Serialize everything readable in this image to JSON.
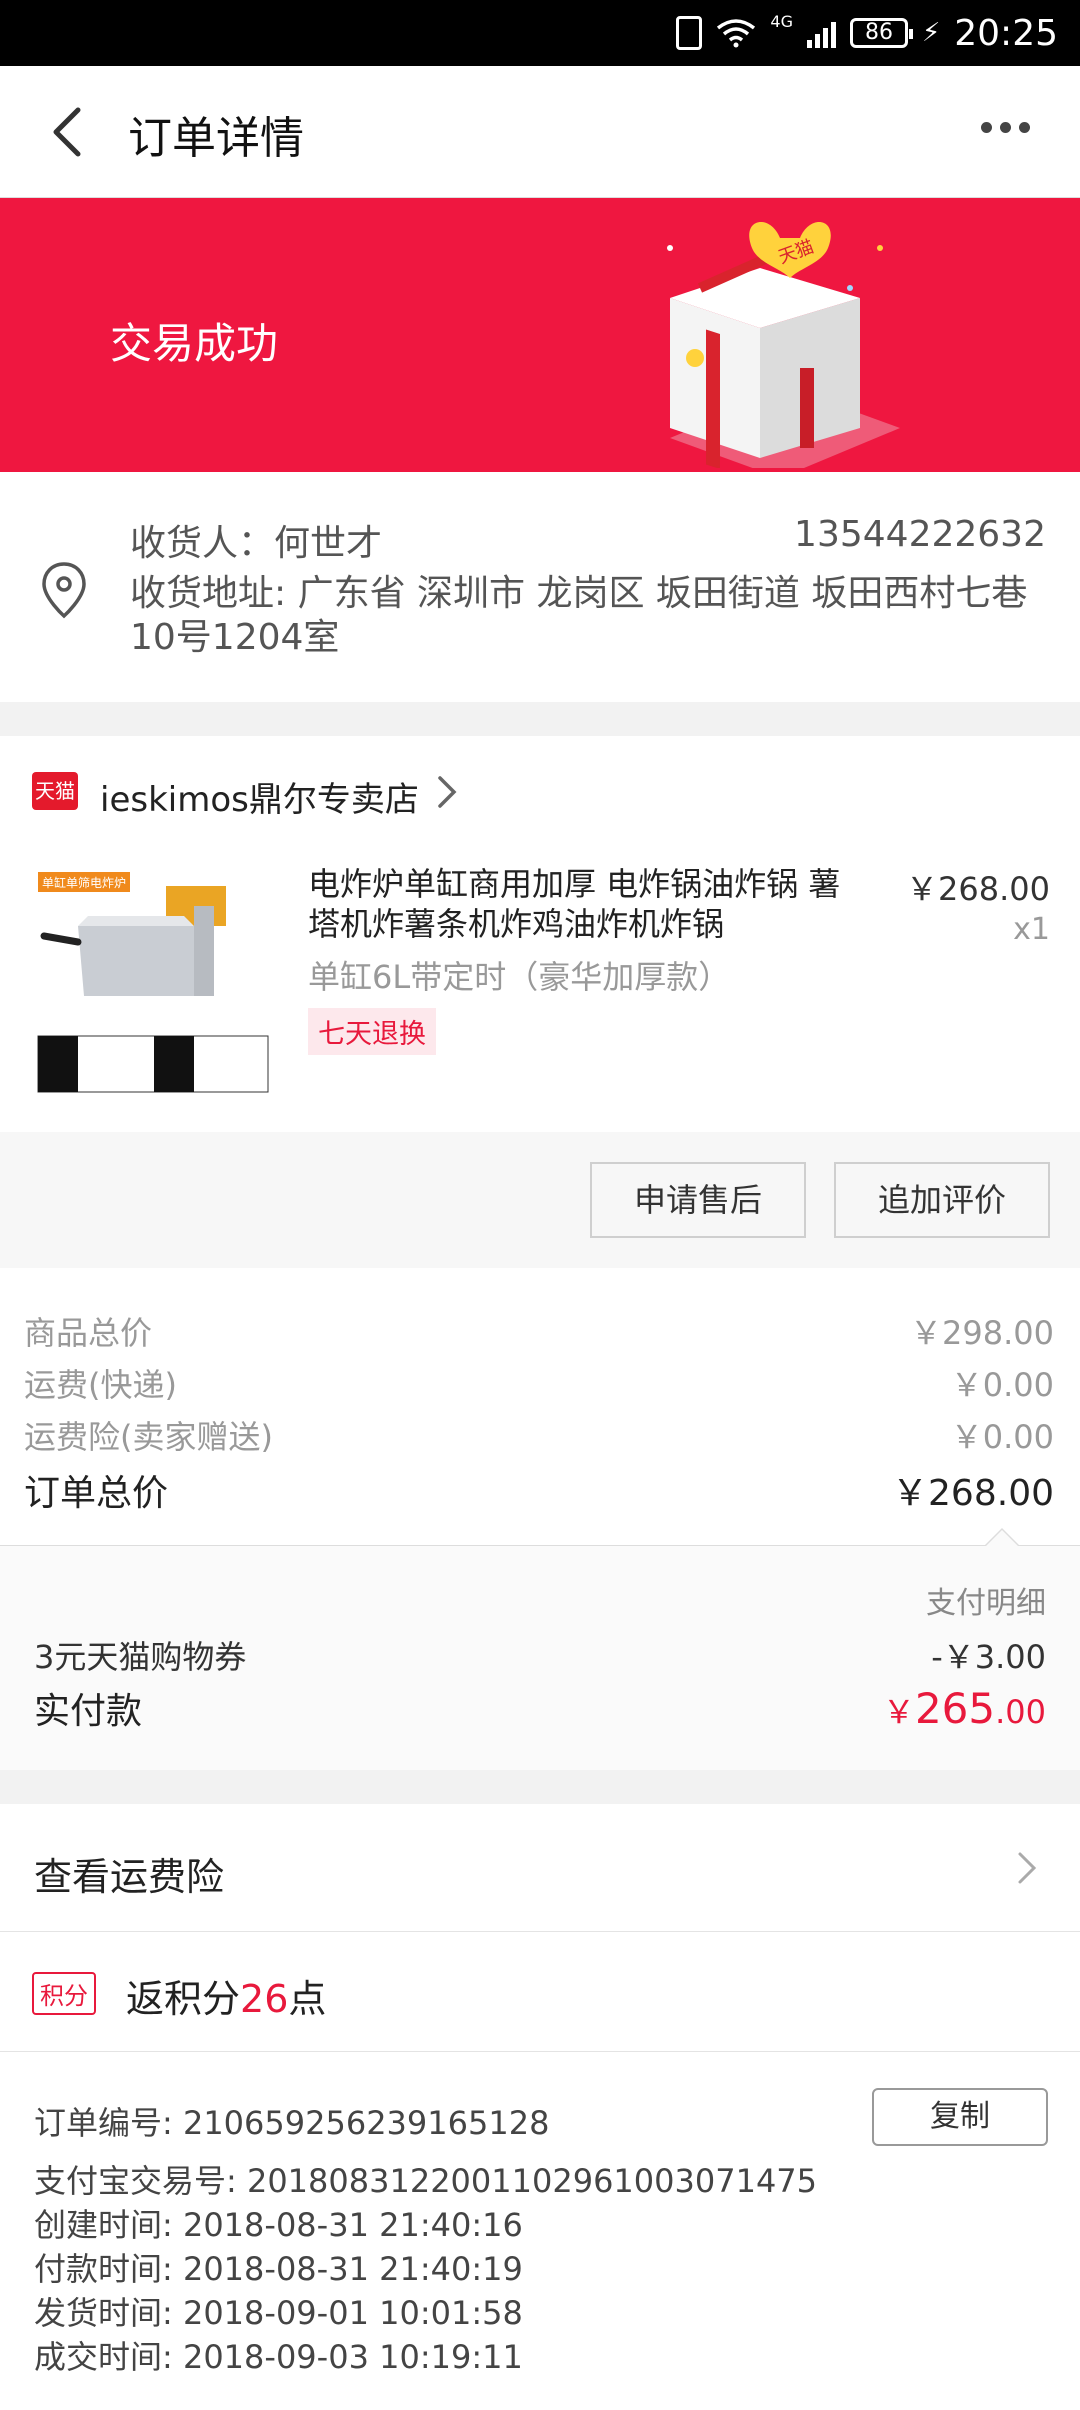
{
  "status_bar": {
    "network": "4G",
    "battery": "86",
    "time": "20:25"
  },
  "header": {
    "title": "订单详情"
  },
  "banner": {
    "status": "交易成功",
    "gift_logo": "天猫"
  },
  "address": {
    "consignee": "收货人：何世才",
    "phone": "13544222632",
    "address": "收货地址: 广东省 深圳市 龙岗区 坂田街道 坂田西村七巷10号1204室"
  },
  "shop": {
    "badge": "天猫",
    "name": "ieskimos鼎尔专卖店",
    "product": {
      "title": "电炸炉单缸商用加厚 电炸锅油炸锅 薯塔机炸薯条机炸鸡油炸机炸锅",
      "price": "￥268.00",
      "qty": "x1",
      "spec": "单缸6L带定时（豪华加厚款）",
      "return_tag": "七天退换",
      "image_label": "单缸单筛电炸炉"
    },
    "actions": {
      "after_sale": "申请售后",
      "add_review": "追加评价"
    }
  },
  "summary": {
    "goods_total_label": "商品总价",
    "goods_total": "￥298.00",
    "shipping_label": "运费(快递)",
    "shipping": "￥0.00",
    "insurance_label": "运费险(卖家赠送)",
    "insurance": "￥0.00",
    "order_total_label": "订单总价",
    "order_total": "￥268.00"
  },
  "payment": {
    "detail_label": "支付明细",
    "coupon_label": "3元天猫购物券",
    "coupon_value": "-￥3.00",
    "paid_label": "实付款",
    "paid_currency": "￥",
    "paid_main": "265",
    "paid_decimal": ".00"
  },
  "insurance_link": {
    "label": "查看运费险"
  },
  "points": {
    "badge": "积分",
    "prefix": "返积分",
    "value": "26",
    "suffix": "点"
  },
  "order_info": {
    "copy_label": "复制",
    "lines": [
      "订单编号: 210659256239165128",
      "支付宝交易号: 2018083122001102961003071475",
      "创建时间: 2018-08-31 21:40:16",
      "付款时间: 2018-08-31 21:40:19",
      "发货时间: 2018-09-01 10:01:58",
      "成交时间: 2018-09-03 10:19:11"
    ]
  }
}
